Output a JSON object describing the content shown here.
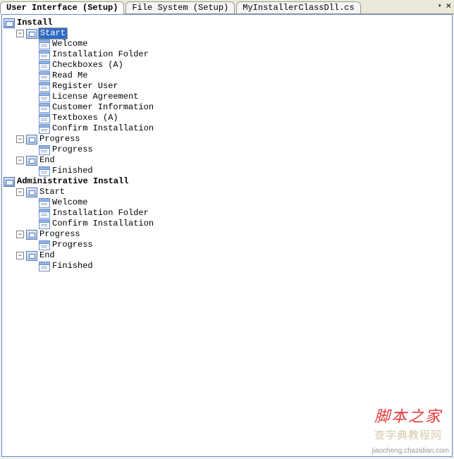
{
  "tabs": {
    "active": "User Interface (Setup)",
    "t1": "File System (Setup)",
    "t2": "MyInstallerClassDll.cs"
  },
  "tree": {
    "install": {
      "title": "Install",
      "start": {
        "title": "Start",
        "items": [
          "Welcome",
          "Installation Folder",
          "Checkboxes  (A)",
          "Read Me",
          "Register User",
          "License Agreement",
          "Customer Information",
          "Textboxes  (A)",
          "Confirm Installation"
        ]
      },
      "progress": {
        "title": "Progress",
        "items": [
          "Progress"
        ]
      },
      "end": {
        "title": "End",
        "items": [
          "Finished"
        ]
      }
    },
    "admin": {
      "title": "Administrative Install",
      "start": {
        "title": "Start",
        "items": [
          "Welcome",
          "Installation Folder",
          "Confirm Installation"
        ]
      },
      "progress": {
        "title": "Progress",
        "items": [
          "Progress"
        ]
      },
      "end": {
        "title": "End",
        "items": [
          "Finished"
        ]
      }
    }
  },
  "watermarks": {
    "red": "脚本之家",
    "tan": "查字典教程网",
    "site": "jiaocheng.chazidian.com"
  }
}
